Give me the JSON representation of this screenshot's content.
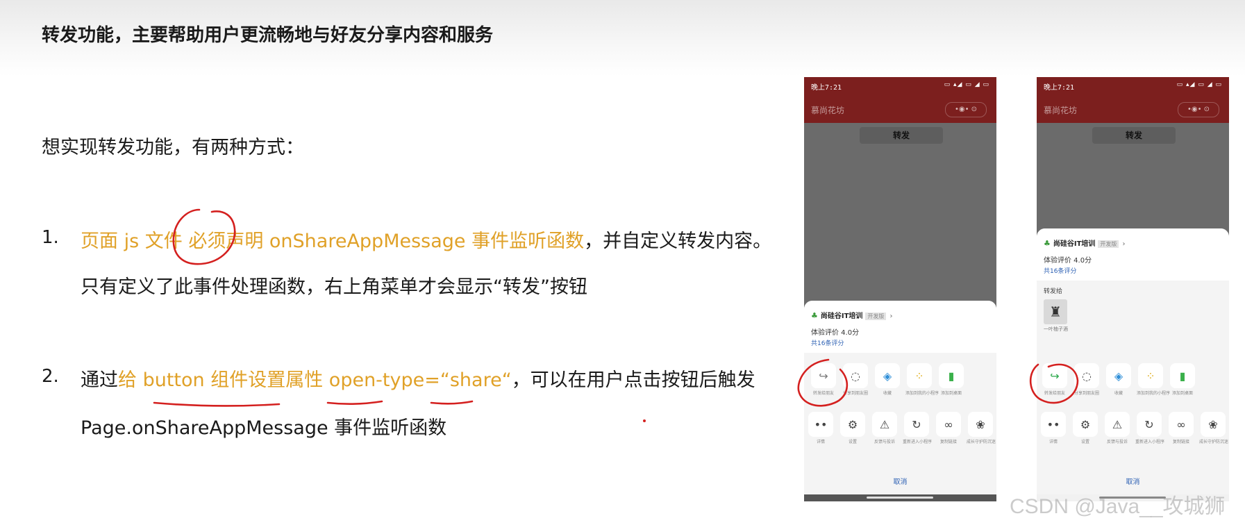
{
  "heading": "转发功能，主要帮助用户更流畅地与好友分享内容和服务",
  "intro": "想实现转发功能，有两种方式：",
  "items": [
    {
      "number": "1.",
      "line1_highlight": "页面 js 文件 必须声明 onShareAppMessage 事件监听函数",
      "line1_rest": "，并自定义转发内容。",
      "line2": "只有定义了此事件处理函数，右上角菜单才会显示“转发”按钮"
    },
    {
      "number": "2.",
      "line1_prefix": "通过",
      "line1_highlight": "给 button 组件设置属性 open-type=“share“",
      "line1_rest": "，可以在用户点击按钮后触发",
      "line2": "Page.onShareAppMessage 事件监听函数"
    }
  ],
  "phone": {
    "time": "晚上7:21",
    "system_icons": "▭ ▴◢ ▭ ◢ ▭",
    "page_title": "慕尚花坊",
    "capsule": "•◉•  ⊙",
    "page_button": "转发",
    "app_name": "尚硅谷IT培训",
    "app_tag": "开发版",
    "rating": "体验评价 4.0分",
    "reviews": "共16条评分",
    "forward_to": "转发给",
    "contact_name": "一叶柚子酒",
    "row1": [
      {
        "icon": "share-arrow-icon",
        "glyph": "↪",
        "label": "转发给朋友"
      },
      {
        "icon": "loading-icon",
        "glyph": "◌",
        "label": "分享到朋友圈"
      },
      {
        "icon": "cube-icon",
        "glyph": "◈",
        "label": "收藏"
      },
      {
        "icon": "grid-icon",
        "glyph": "⁘",
        "label": "添加到我的小程序"
      },
      {
        "icon": "desktop-icon",
        "glyph": "▮",
        "label": "添加到桌面"
      }
    ],
    "row2": [
      {
        "icon": "more-icon",
        "glyph": "••",
        "label": "详情"
      },
      {
        "icon": "gear-icon",
        "glyph": "⚙",
        "label": "设置"
      },
      {
        "icon": "warning-icon",
        "glyph": "⚠",
        "label": "反馈与投诉"
      },
      {
        "icon": "reload-icon",
        "glyph": "↻",
        "label": "重新进入小程序"
      },
      {
        "icon": "link-icon",
        "glyph": "∞",
        "label": "复制链接"
      },
      {
        "icon": "sprout-icon",
        "glyph": "❀",
        "label": "成长守护防沉迷"
      }
    ],
    "cancel": "取消"
  },
  "watermark": "CSDN @Java__攻城狮",
  "colors": {
    "highlight": "#e0a128",
    "annotation_red": "#d4201f",
    "header_red": "#7c1f1e"
  }
}
